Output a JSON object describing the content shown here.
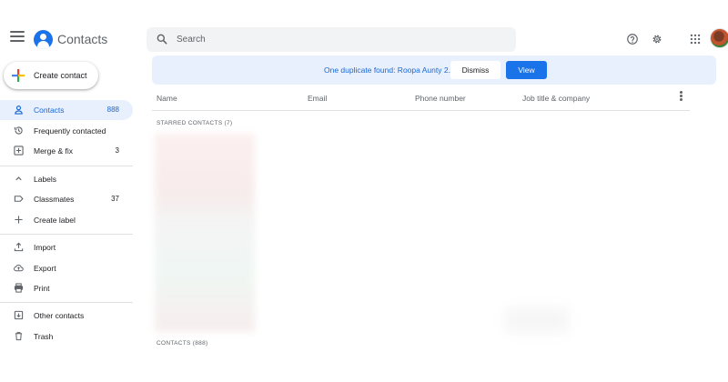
{
  "app": {
    "title": "Contacts"
  },
  "search": {
    "placeholder": "Search"
  },
  "sidebar": {
    "create_label": "Create contact",
    "items": [
      {
        "label": "Contacts",
        "count": "888"
      },
      {
        "label": "Frequently contacted",
        "count": ""
      },
      {
        "label": "Merge & fix",
        "count": "3"
      },
      {
        "label": "Labels",
        "count": ""
      },
      {
        "label": "Classmates",
        "count": "37"
      },
      {
        "label": "Create label",
        "count": ""
      },
      {
        "label": "Import",
        "count": ""
      },
      {
        "label": "Export",
        "count": ""
      },
      {
        "label": "Print",
        "count": ""
      },
      {
        "label": "Other contacts",
        "count": ""
      },
      {
        "label": "Trash",
        "count": ""
      }
    ]
  },
  "banner": {
    "message": "One duplicate found: Roopa Aunty 2.",
    "dismiss_label": "Dismiss",
    "view_label": "View"
  },
  "table": {
    "columns": [
      "Name",
      "Email",
      "Phone number",
      "Job title & company"
    ],
    "starred_section": "STARRED CONTACTS (7)",
    "contacts_section": "CONTACTS (888)"
  },
  "icons": {
    "menu": "menu-icon",
    "search": "search-icon",
    "help": "help-icon",
    "settings": "gear-icon",
    "apps": "apps-grid-icon"
  },
  "colors": {
    "accent": "#1a73e8",
    "active_bg": "#e8f0fe",
    "active_text": "#1967d2"
  }
}
